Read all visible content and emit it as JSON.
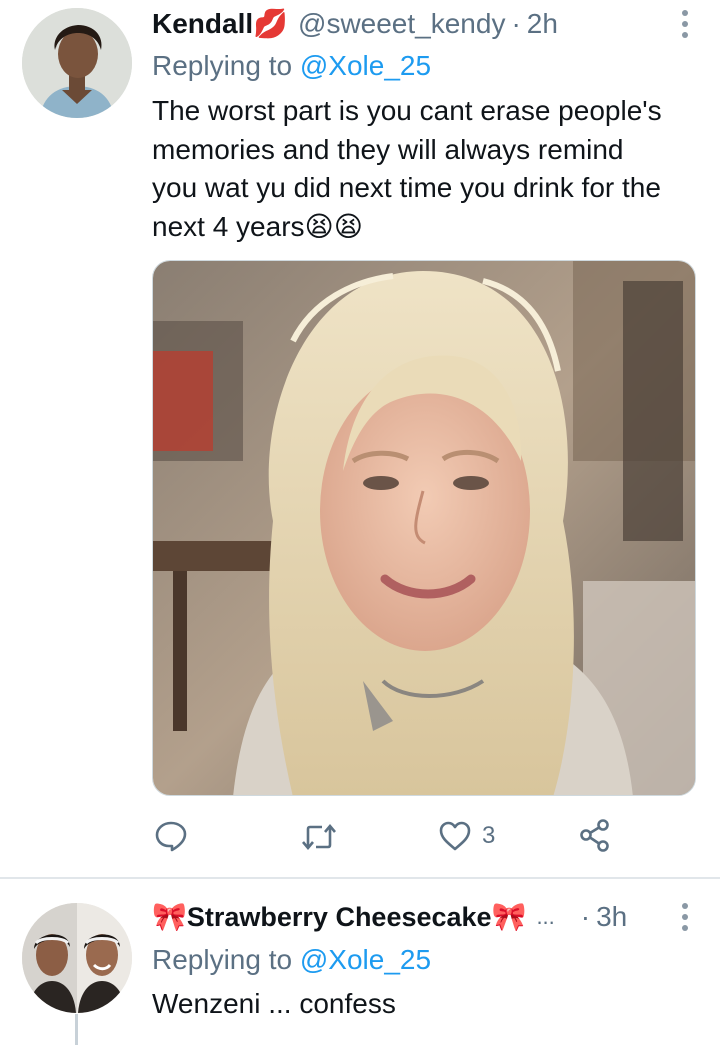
{
  "tweets": [
    {
      "author_name": "Kendall",
      "name_emoji": "💋",
      "handle": "@sweeet_kendy",
      "separator": "·",
      "time": "2h",
      "replying_prefix": "Replying to ",
      "replying_mention": "@Xole_25",
      "text_lines": [
        "The worst part is you cant erase people's",
        "memories and they will always remind",
        "you wat yu did next time you drink for the",
        "next 4 years😫😫"
      ],
      "actions": {
        "reply_icon": "reply-icon",
        "retweet_icon": "retweet-icon",
        "like_icon": "heart-icon",
        "like_count": "3",
        "share_icon": "share-icon"
      }
    },
    {
      "name_prefix_emoji": "🎀",
      "author_name": "Strawberry Cheesecake",
      "name_suffix_emoji": "🎀",
      "truncation": "...",
      "separator": "·",
      "time": "3h",
      "replying_prefix": "Replying to ",
      "replying_mention": "@Xole_25",
      "text": "Wenzeni ... confess"
    }
  ],
  "colors": {
    "link": "#1d9bf0",
    "secondary_text": "#5b7083",
    "primary_text": "#0f1419",
    "divider": "#e1e6ea"
  }
}
